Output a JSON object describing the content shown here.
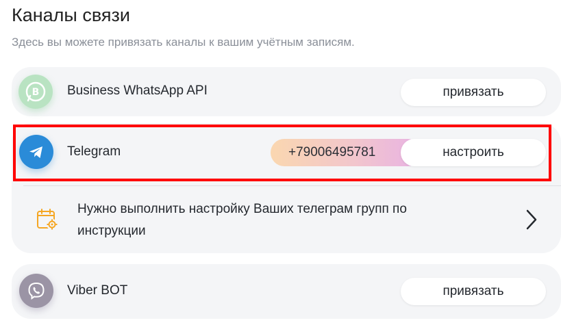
{
  "page": {
    "title": "Каналы связи",
    "subtitle": "Здесь вы можете привязать каналы к вашим учётным записям."
  },
  "channels": {
    "whatsapp": {
      "name": "Business WhatsApp API",
      "button_label": "привязать",
      "icon": "whatsapp-business-icon"
    },
    "telegram": {
      "name": "Telegram",
      "phone": "+79006495781",
      "button_label": "настроить",
      "icon": "telegram-icon",
      "notice": "Нужно выполнить настройку Ваших телеграм групп по инструкции",
      "notice_icon": "calendar-settings-icon"
    },
    "viber": {
      "name": "Viber BOT",
      "button_label": "привязать",
      "icon": "viber-icon"
    }
  },
  "colors": {
    "card_bg": "#f4f5f7",
    "telegram_blue": "#2a8bd8",
    "highlight_frame": "#ff0000",
    "notice_icon": "#f5a623"
  }
}
